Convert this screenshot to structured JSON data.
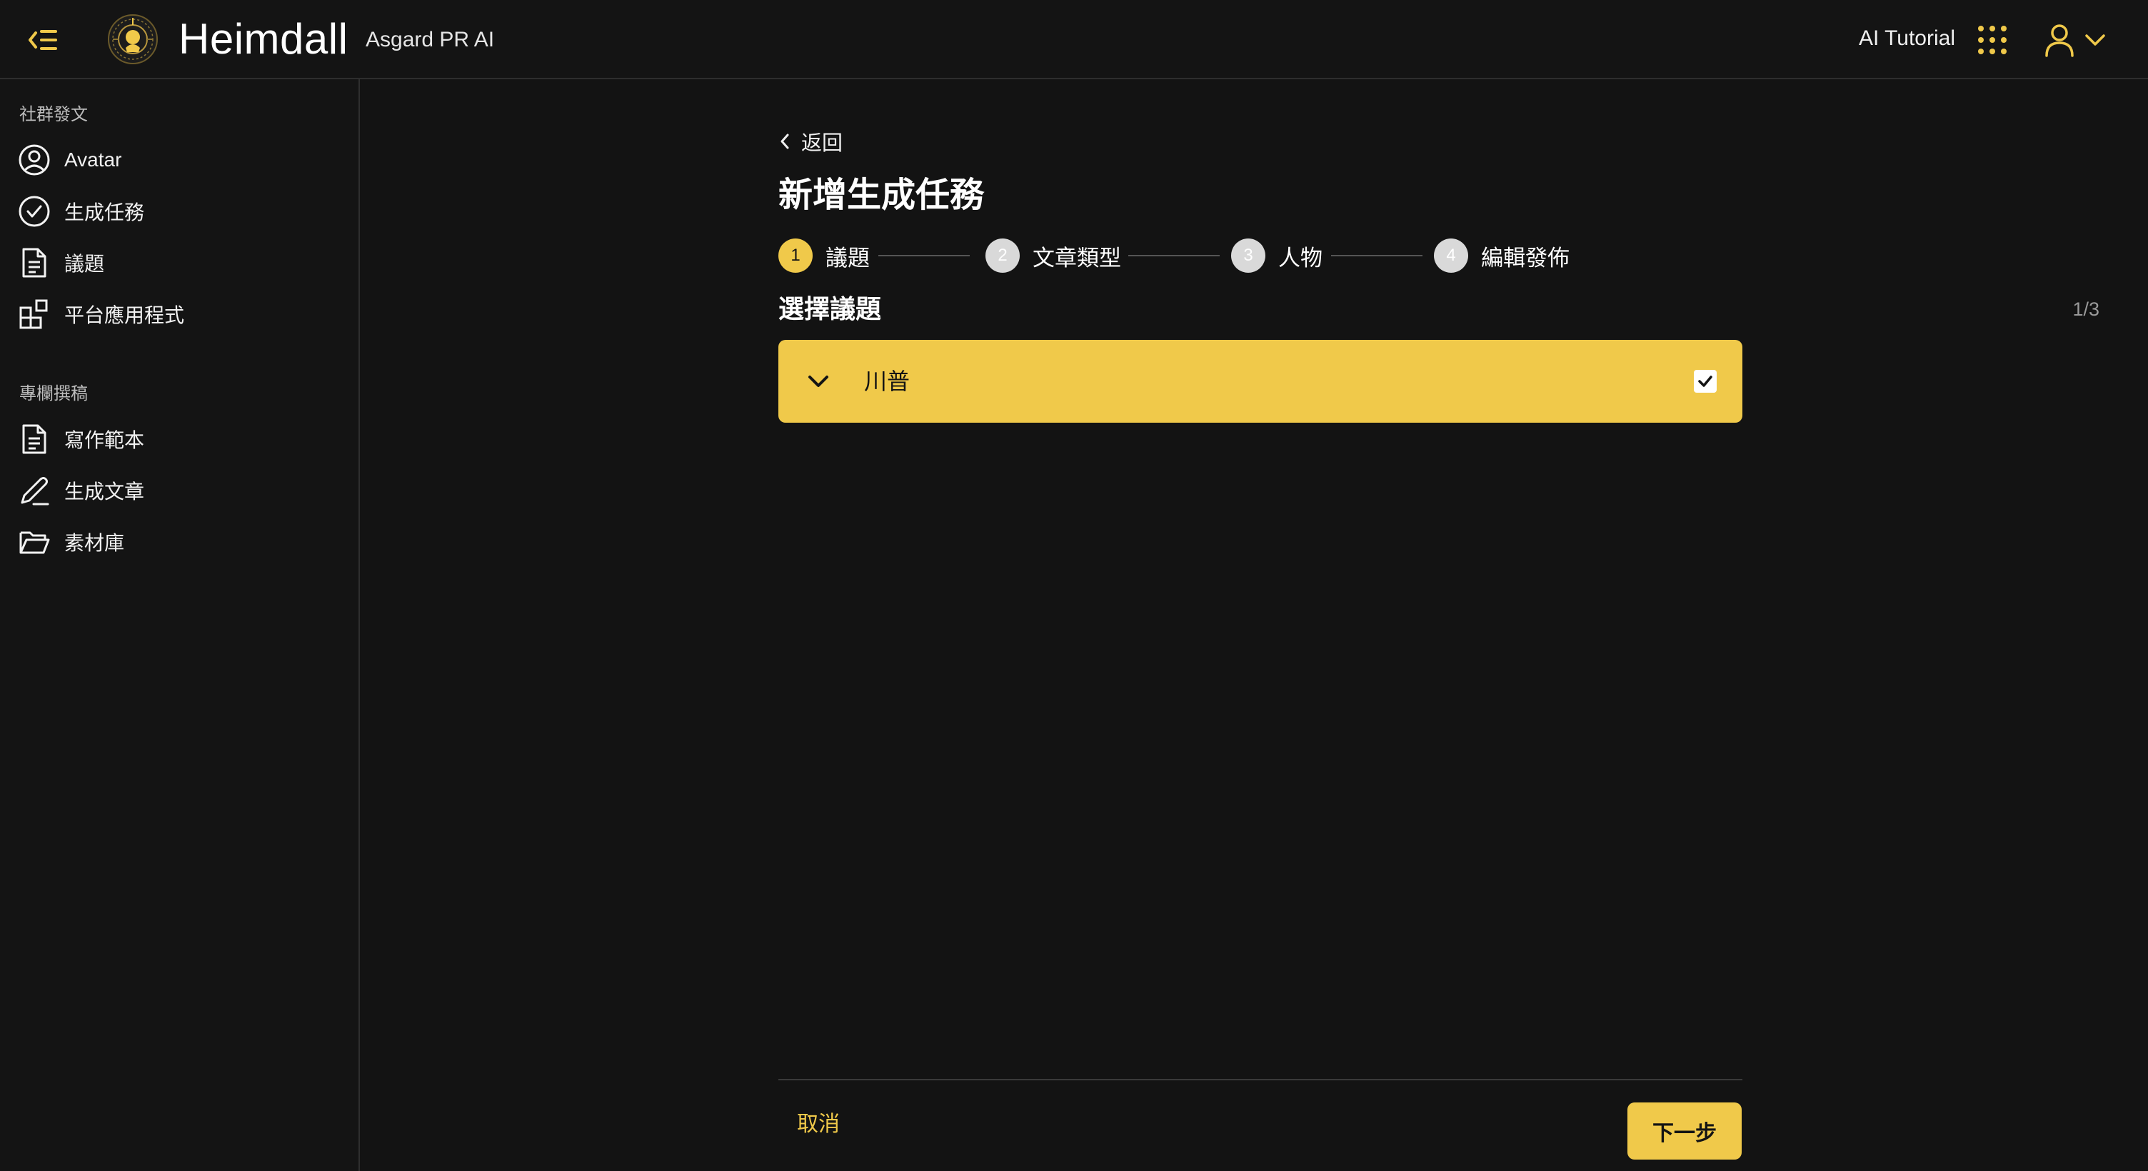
{
  "header": {
    "brand": "Heimdall",
    "subbrand": "Asgard PR AI",
    "tutorial_label": "AI Tutorial"
  },
  "sidebar": {
    "sections": [
      {
        "title": "社群發文",
        "items": [
          {
            "label": "Avatar",
            "icon": "user-circle-icon"
          },
          {
            "label": "生成任務",
            "icon": "check-circle-icon"
          },
          {
            "label": "議題",
            "icon": "document-icon"
          },
          {
            "label": "平台應用程式",
            "icon": "apps-grid-icon"
          }
        ]
      },
      {
        "title": "專欄撰稿",
        "items": [
          {
            "label": "寫作範本",
            "icon": "document-icon"
          },
          {
            "label": "生成文章",
            "icon": "pen-icon"
          },
          {
            "label": "素材庫",
            "icon": "folder-icon"
          }
        ]
      }
    ]
  },
  "main": {
    "back_label": "返回",
    "title": "新增生成任務",
    "steps": [
      {
        "num": "1",
        "label": "議題",
        "state": "active"
      },
      {
        "num": "2",
        "label": "文章類型",
        "state": "pending"
      },
      {
        "num": "3",
        "label": "人物",
        "state": "pending"
      },
      {
        "num": "4",
        "label": "編輯發佈",
        "state": "pending"
      }
    ],
    "section_heading": "選擇議題",
    "counter": "1/3",
    "topics": [
      {
        "label": "川普",
        "checked": true
      }
    ],
    "cancel_label": "取消",
    "next_label": "下一步"
  },
  "colors": {
    "accent": "#f0c94a",
    "background": "#131313",
    "text": "#ffffff"
  }
}
